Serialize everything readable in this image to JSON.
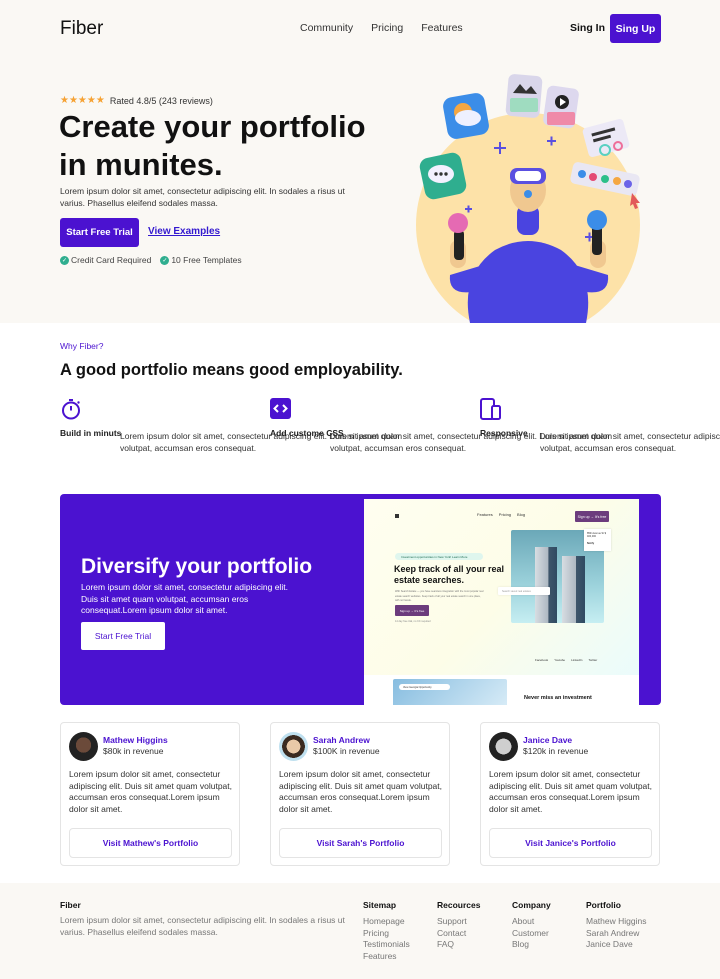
{
  "nav": {
    "logo": "Fiber",
    "links": [
      "Community",
      "Pricing",
      "Features"
    ],
    "signin": "Sing In",
    "signup": "Sing Up"
  },
  "hero": {
    "stars": "★★★★★",
    "rating_text": "Rated 4.8/5 (243 reviews)",
    "rating": 4.8,
    "title": "Create your portfolio in munites.",
    "description": "Lorem ipsum dolor sit amet, consectetur adipiscing elit. In sodales a risus ut varius. Phasellus eleifend sodales massa.",
    "primary_button": "Start Free Trial",
    "secondary_link": "View Examples",
    "checks": [
      "Credit Card Required",
      "10 Free Templates"
    ],
    "check_glyph": "✓"
  },
  "why": {
    "eyebrow": "Why Fiber?",
    "title": "A good portfolio means good employability.",
    "features": [
      {
        "icon": "stopwatch-icon",
        "title": "Build in minuts",
        "description": "Lorem ipsum dolor sit amet, consectetur adipiscing elit. Duis sit amet quam volutpat, accumsan eros consequat."
      },
      {
        "icon": "code-icon",
        "title": "Add custome CSS",
        "description": "Lorem ipsum dolor sit amet, consectetur adipiscing elit. Duis sit amet quam volutpat, accumsan eros consequat."
      },
      {
        "icon": "devices-icon",
        "title": "Responsive",
        "description": "Lorem ipsum dolor sit amet, consectetur adipiscing elit. Duis sit amet quam volutpat, accumsan eros consequat."
      }
    ]
  },
  "banner": {
    "title": "Diversify your portfolio",
    "description": "Lorem ipsum dolor sit amet, consectetur adipiscing elit. Duis sit amet quam volutpat, accumsan eros consequat.Lorem ipsum dolor sit amet.",
    "button": "Start Free Trial",
    "mockup": {
      "nav_links": [
        "Features",
        "Pricing",
        "Blog"
      ],
      "signup": "Sign up → It's free",
      "pill": "Investment opportunities in New York! Learn More",
      "title": "Keep track of all your real estate searches.",
      "description": "With Search Estate — you have seamless integration with the most popular real estate search websites. Keep track of all your real estate search in one place, with no hassle.",
      "button": "Sign up → It's free",
      "note": "14 day free trial, no CC required",
      "search_placeholder": "Search saved real estates",
      "card_text": "85th Avenue St $ 400,000",
      "card_notify": "Notify",
      "social": [
        "Facebook",
        "Youtube",
        "LinkedIn",
        "Twitter"
      ],
      "bottom_pill": "View Georgia Opportunity",
      "bottom_title": "Never miss an investment"
    }
  },
  "testimonials": [
    {
      "name": "Mathew Higgins",
      "revenue": "$80k in revenue",
      "text": "Lorem ipsum dolor sit amet, consectetur adipiscing elit. Duis sit amet quam volutpat, accumsan eros consequat.Lorem ipsum dolor sit amet.",
      "button": "Visit Mathew's Portfolio"
    },
    {
      "name": "Sarah Andrew",
      "revenue": "$100K in revenue",
      "text": "Lorem ipsum dolor sit amet, consectetur adipiscing elit. Duis sit amet quam volutpat, accumsan eros consequat.Lorem ipsum dolor sit amet.",
      "button": "Visit Sarah's Portfolio"
    },
    {
      "name": "Janice Dave",
      "revenue": "$120k in revenue",
      "text": "Lorem ipsum dolor sit amet, consectetur adipiscing elit. Duis sit amet quam volutpat, accumsan eros consequat.Lorem ipsum dolor sit amet.",
      "button": "Visit Janice's Portfolio"
    }
  ],
  "footer": {
    "logo": "Fiber",
    "description": "Lorem ipsum dolor sit amet, consectetur adipiscing elit. In sodales a risus ut varius. Phasellus eleifend sodales massa.",
    "columns": [
      {
        "heading": "Sitemap",
        "links": [
          "Homepage",
          "Pricing",
          "Testimonials",
          "Features"
        ]
      },
      {
        "heading": "Recources",
        "links": [
          "Support",
          "Contact",
          "FAQ"
        ]
      },
      {
        "heading": "Company",
        "links": [
          "About",
          "Customer",
          "Blog"
        ]
      },
      {
        "heading": "Portfolio",
        "links": [
          "Mathew Higgins",
          "Sarah Andrew",
          "Janice Dave"
        ]
      }
    ]
  },
  "colors": {
    "brand": "#4b12d0",
    "hero_bg": "#faf8f4",
    "star": "#f6a234",
    "check": "#2fae8f"
  }
}
